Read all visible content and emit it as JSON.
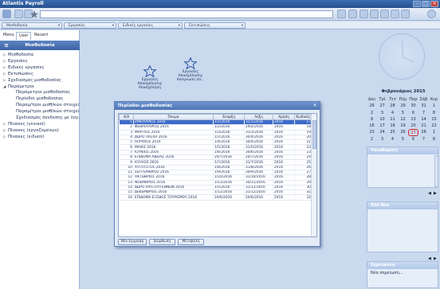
{
  "app": {
    "title": "Atlantis Payroll"
  },
  "tabs": [
    {
      "label": "Μισθοδοσία"
    },
    {
      "label": "Εργασίες"
    },
    {
      "label": "Ειδικές εργασίες"
    },
    {
      "label": "Εκτυπώσεις"
    }
  ],
  "sidebar": {
    "tabs": [
      "Menu",
      "User",
      "Recent"
    ],
    "header": "Μισθοδοσία",
    "items": [
      {
        "label": "Μισθοδοσία",
        "arrow": "▷",
        "indent": 0
      },
      {
        "label": "Εργασίες",
        "arrow": "▷",
        "indent": 0
      },
      {
        "label": "Ειδικές εργασίες",
        "arrow": "▷",
        "indent": 0
      },
      {
        "label": "Εκτυπώσεις",
        "arrow": "▷",
        "indent": 0
      },
      {
        "label": "Σχεδιασμός μισθοδοσίας",
        "arrow": "▷",
        "indent": 0
      },
      {
        "label": "Παράμετροι",
        "arrow": "◢",
        "indent": 0
      },
      {
        "label": "Παράμετροι μισθοδοσίας",
        "arrow": "",
        "indent": 1
      },
      {
        "label": "Περίοδοι μισθοδοσίας",
        "arrow": "",
        "indent": 1
      },
      {
        "label": "Παραμ/τροι μισθ/κών στοιχεί...",
        "arrow": "",
        "indent": 1
      },
      {
        "label": "Παραμ/τροι μισθ/κών στοιχεί...",
        "arrow": "",
        "indent": 1
      },
      {
        "label": "Σχεδιασμός σύνδεσης με λογ...",
        "arrow": "",
        "indent": 1
      },
      {
        "label": "Πίνακες (γενικοί)",
        "arrow": "▷",
        "indent": 0
      },
      {
        "label": "Πίνακες (εργαζομένων)",
        "arrow": "▷",
        "indent": 0
      },
      {
        "label": "Πίνακες (ειδικοί)",
        "arrow": "▷",
        "indent": 0
      }
    ]
  },
  "desktop": [
    {
      "label": "Εργασίες Απασχόλησης Απασχόληση"
    },
    {
      "label": "Εργασίες Απασχόλησης Ανάγνωση απ..."
    }
  ],
  "dialog": {
    "title": "Περίοδοι μισθοδοσίας",
    "columns": [
      "Α/Α",
      "Όνομα",
      "Έναρξη",
      "Λήξη",
      "Χρήση",
      "Κωδικός"
    ],
    "rows": [
      [
        "1",
        "ΙΑΝΟΥΑΡΙΟΣ 2016",
        "1/1/2016",
        "31/1/2016",
        "2016",
        "17"
      ],
      [
        "2",
        "ΦΕΒΡΟΥΑΡΙΟΣ 2016",
        "1/2/2016",
        "29/2/2016",
        "2016",
        "18"
      ],
      [
        "3",
        "ΜΑΡΤΙΟΣ 2016",
        "1/3/2016",
        "31/3/2016",
        "2016",
        "19"
      ],
      [
        "4",
        "ΔΩΡΟ ΠΑΣΧΑ 2016",
        "1/1/2016",
        "30/4/2016",
        "2016",
        "20"
      ],
      [
        "5",
        "ΑΠΡΙΛΙΟΣ 2016",
        "1/4/2016",
        "30/4/2016",
        "2016",
        "21"
      ],
      [
        "6",
        "ΜΑΙΟΣ 2016",
        "1/5/2016",
        "31/5/2016",
        "2016",
        "22"
      ],
      [
        "7",
        "ΙΟΥΝΙΟΣ 2016",
        "1/6/2016",
        "30/6/2016",
        "2016",
        "23"
      ],
      [
        "8",
        "ΕΠΙΔΟΜΑ ΑΔΕΙΑΣ 2016",
        "20/7/2016",
        "20/7/2016",
        "2016",
        "24"
      ],
      [
        "9",
        "ΙΟΥΛΙΟΣ 2016",
        "1/7/2016",
        "31/7/2016",
        "2016",
        "25"
      ],
      [
        "10",
        "ΑΥΓΟΥΣΤΟΣ 2016",
        "1/8/2016",
        "31/8/2016",
        "2016",
        "26"
      ],
      [
        "11",
        "ΣΕΠΤΕΜΒΡΙΟΣ 2016",
        "1/9/2016",
        "30/9/2016",
        "2016",
        "27"
      ],
      [
        "12",
        "ΟΚΤΩΒΡΙΟΣ 2016",
        "1/10/2016",
        "31/10/2016",
        "2016",
        "28"
      ],
      [
        "13",
        "ΝΟΕΜΒΡΙΟΣ 2016",
        "1/11/2016",
        "30/11/2016",
        "2016",
        "29"
      ],
      [
        "14",
        "ΔΩΡΟ ΧΡΙΣΤΟΥΓΕΝΝΩΝ 2016",
        "1/5/2016",
        "31/12/2016",
        "2016",
        "30"
      ],
      [
        "15",
        "ΔΕΚΕΜΒΡΙΟΣ 2016",
        "1/12/2016",
        "31/12/2016",
        "2016",
        "31"
      ],
      [
        "16",
        "ΕΠΙΔΟΜΑ ΕΞΟΔΟΣ ΤΟΥΡΙΣΜΟΥ 2016",
        "20/6/2016",
        "20/6/2016",
        "2016",
        "32"
      ]
    ],
    "selected_index": 0,
    "buttons": {
      "new": "Νέα Εγγραφή",
      "edit": "Διόρθωση",
      "change": "Μεταβολή"
    }
  },
  "calendar": {
    "title": "Φεβρουάριος 2015",
    "days_of_week": [
      "Δευ",
      "Τρί",
      "Τετ",
      "Πέμ",
      "Παρ",
      "Σάβ",
      "Κυρ"
    ],
    "cells": [
      "26",
      "27",
      "28",
      "29",
      "30",
      "31",
      "1",
      "2",
      "3",
      "4",
      "5",
      "6",
      "7",
      "8",
      "9",
      "10",
      "11",
      "12",
      "13",
      "14",
      "15",
      "16",
      "17",
      "18",
      "19",
      "20",
      "21",
      "22",
      "23",
      "24",
      "25",
      "26",
      "27",
      "28",
      "1",
      "2",
      "3",
      "4",
      "5",
      "6",
      "7",
      "8"
    ],
    "today": "27"
  },
  "right": {
    "section1": "Υπενθύμιση",
    "section2": "RSS Νέα",
    "section3": "Σημειώσεις",
    "note_placeholder": "Νέα σημείωση..."
  }
}
